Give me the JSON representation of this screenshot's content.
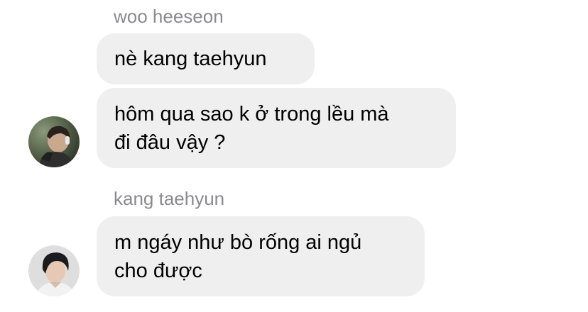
{
  "messages": {
    "group1": {
      "sender": "woo heeseon",
      "avatar_icon": "user-avatar-photo-icon",
      "bubbles": [
        "nè kang taehyun",
        "hôm qua sao k ở trong lều mà\nđi đâu vậy ?"
      ]
    },
    "group2": {
      "sender": "kang taehyun",
      "avatar_icon": "user-avatar-photo-icon",
      "bubbles": [
        "m ngáy như bò rống ai ngủ\ncho được"
      ]
    }
  },
  "colors": {
    "bubble_bg": "#efefef",
    "sender_name": "#8a8a8e",
    "message_text": "#000000"
  }
}
